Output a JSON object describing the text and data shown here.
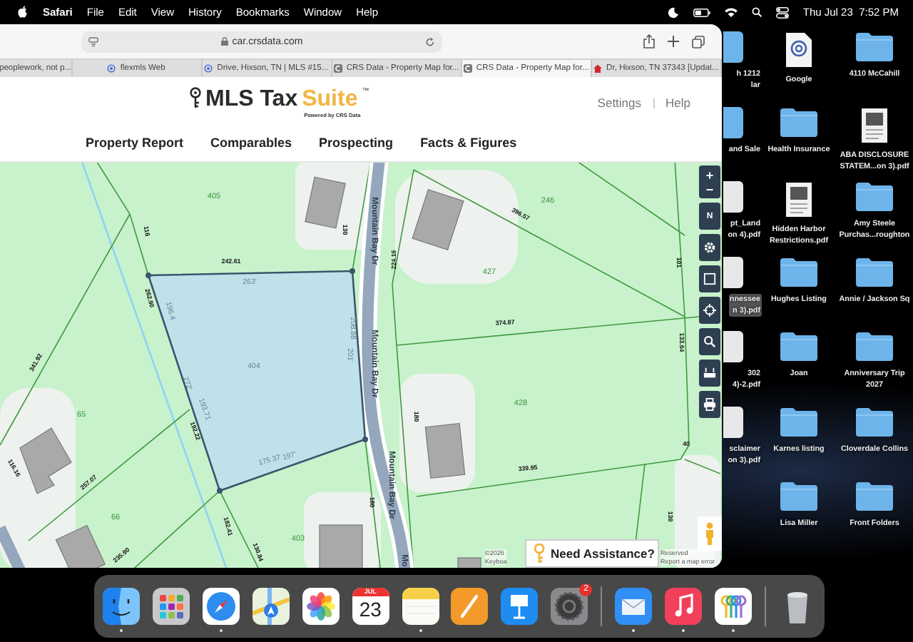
{
  "menubar": {
    "app": "Safari",
    "menus": [
      "File",
      "Edit",
      "View",
      "History",
      "Bookmarks",
      "Window",
      "Help"
    ],
    "clock": "Thu Jul 23  7:52 PM"
  },
  "browser": {
    "url": "car.crsdata.com",
    "tabs": [
      {
        "title": "peoplework, not p...",
        "kind": "plain",
        "selected": false
      },
      {
        "title": "flexmls Web",
        "kind": "pin",
        "selected": false
      },
      {
        "title": "Drive, Hixson, TN | MLS #15...",
        "kind": "pin",
        "selected": false
      },
      {
        "title": "CRS Data - Property Map for...",
        "kind": "crs",
        "selected": false
      },
      {
        "title": "CRS Data - Property Map for...",
        "kind": "crs",
        "selected": true
      },
      {
        "title": "Dr, Hixson, TN 37343 [Updat...",
        "kind": "house",
        "selected": false
      }
    ]
  },
  "site": {
    "logo": {
      "name": "MLS Tax",
      "accent": "Suite",
      "mark": "™",
      "tagline": "Powered by CRS Data"
    },
    "links": [
      "Settings",
      "Help"
    ],
    "nav": [
      "Property Report",
      "Comparables",
      "Prospecting",
      "Facts & Figures"
    ]
  },
  "map": {
    "labels": [
      {
        "text": "405",
        "kind": "lot"
      },
      {
        "text": "130",
        "kind": "dim"
      },
      {
        "text": "116",
        "kind": "dim"
      },
      {
        "text": "242.61",
        "kind": "dim"
      },
      {
        "text": "263'",
        "kind": "line"
      },
      {
        "text": "262.90",
        "kind": "dim"
      },
      {
        "text": "196.4",
        "kind": "line"
      },
      {
        "text": "208.88",
        "kind": "line"
      },
      {
        "text": "201'",
        "kind": "line"
      },
      {
        "text": "404",
        "kind": "line"
      },
      {
        "text": "Mountain Bay Dr",
        "kind": "street"
      },
      {
        "text": "Mountain Bay Dr",
        "kind": "street"
      },
      {
        "text": "Mountain Bay Dr",
        "kind": "street"
      },
      {
        "text": "224.16",
        "kind": "dim"
      },
      {
        "text": "246",
        "kind": "lot"
      },
      {
        "text": "396.57",
        "kind": "dim"
      },
      {
        "text": "427",
        "kind": "lot"
      },
      {
        "text": "374.87",
        "kind": "dim"
      },
      {
        "text": "428",
        "kind": "lot"
      },
      {
        "text": "180",
        "kind": "dim"
      },
      {
        "text": "339.95",
        "kind": "dim"
      },
      {
        "text": "341.92",
        "kind": "dim"
      },
      {
        "text": "272'",
        "kind": "line"
      },
      {
        "text": "193.71",
        "kind": "line"
      },
      {
        "text": "65",
        "kind": "lot"
      },
      {
        "text": "192.22",
        "kind": "dim"
      },
      {
        "text": "175.37",
        "kind": "line"
      },
      {
        "text": "197'",
        "kind": "line"
      },
      {
        "text": "116.16",
        "kind": "dim"
      },
      {
        "text": "257.07",
        "kind": "dim"
      },
      {
        "text": "66",
        "kind": "lot"
      },
      {
        "text": "182.41",
        "kind": "dim"
      },
      {
        "text": "403",
        "kind": "lot"
      },
      {
        "text": "130.84",
        "kind": "dim"
      },
      {
        "text": "180",
        "kind": "dim"
      },
      {
        "text": "235.90",
        "kind": "dim"
      },
      {
        "text": "133.64",
        "kind": "dim"
      },
      {
        "text": "40",
        "kind": "dim"
      },
      {
        "text": "130",
        "kind": "dim"
      },
      {
        "text": "101",
        "kind": "dim"
      },
      {
        "text": "Mo",
        "kind": "street"
      }
    ],
    "zoom": {
      "in": "+",
      "out": "−"
    },
    "compass": "N",
    "tools": [
      {
        "kind": "settings"
      },
      {
        "kind": "select"
      },
      {
        "kind": "locate"
      },
      {
        "kind": "search"
      },
      {
        "kind": "measure"
      },
      {
        "kind": "print"
      }
    ],
    "assist": "Need Assistance?",
    "attribution_left": [
      "©2026",
      "Keyboa"
    ],
    "attribution_right": [
      "Reserved",
      "Report a map error"
    ]
  },
  "desktop": {
    "columns": [
      {
        "items": [
          {
            "kind": "folder",
            "lines": [
              "h 1212",
              "lar"
            ],
            "selected": false
          },
          {
            "kind": "folder",
            "lines": [
              "and  Sale"
            ],
            "selected": false
          },
          {
            "kind": "document",
            "lines": [
              "pt_Land",
              "on 4).pdf"
            ],
            "selected": false
          },
          {
            "kind": "document",
            "lines": [
              "nnessee",
              "n 3).pdf"
            ],
            "selected": true
          },
          {
            "kind": "document",
            "lines": [
              "302",
              "4)-2.pdf"
            ],
            "selected": false
          },
          {
            "kind": "document",
            "lines": [
              "sclaimer",
              "on 3).pdf"
            ],
            "selected": false
          }
        ]
      },
      {
        "items": [
          {
            "kind": "link",
            "lines": [
              "Google"
            ],
            "selected": false
          },
          {
            "kind": "folder",
            "lines": [
              "Health Insurance"
            ],
            "selected": false
          },
          {
            "kind": "document",
            "lines": [
              "Hidden Harbor",
              "Restrictions.pdf"
            ],
            "selected": false
          },
          {
            "kind": "folder",
            "lines": [
              "Hughes Listing"
            ],
            "selected": false
          },
          {
            "kind": "folder",
            "lines": [
              "Joan"
            ],
            "selected": false
          },
          {
            "kind": "folder",
            "lines": [
              "Karnes listing"
            ],
            "selected": false
          },
          {
            "kind": "folder",
            "lines": [
              "Lisa Miller"
            ],
            "selected": false
          }
        ]
      },
      {
        "items": [
          {
            "kind": "folder",
            "lines": [
              "4110 McCahill"
            ],
            "selected": false
          },
          {
            "kind": "document",
            "lines": [
              "ABA DISCLOSURE",
              "STATEM...on 3).pdf"
            ],
            "selected": false
          },
          {
            "kind": "folder",
            "lines": [
              "Amy Steele",
              "Purchas...roughton"
            ],
            "selected": false
          },
          {
            "kind": "folder",
            "lines": [
              "Annie / Jackson Sq"
            ],
            "selected": false
          },
          {
            "kind": "folder",
            "lines": [
              "Anniversary Trip",
              "2027"
            ],
            "selected": false
          },
          {
            "kind": "folder",
            "lines": [
              "Cloverdale Collins"
            ],
            "selected": false
          },
          {
            "kind": "folder",
            "lines": [
              "Front Folders"
            ],
            "selected": false
          }
        ]
      }
    ]
  },
  "dock": {
    "items": [
      {
        "kind": "finder",
        "running": true
      },
      {
        "kind": "launchpad",
        "running": false
      },
      {
        "kind": "safari",
        "running": true
      },
      {
        "kind": "maps",
        "running": false
      },
      {
        "kind": "photos",
        "running": false
      },
      {
        "kind": "calendar",
        "running": false,
        "month": "JUL",
        "day": "23"
      },
      {
        "kind": "notes",
        "running": true
      },
      {
        "kind": "pages",
        "running": false
      },
      {
        "kind": "keynote",
        "running": false
      },
      {
        "kind": "settings",
        "running": false,
        "badge": "2"
      },
      {
        "kind": "separator"
      },
      {
        "kind": "mail",
        "running": true
      },
      {
        "kind": "music",
        "running": true
      },
      {
        "kind": "passwords",
        "running": true
      },
      {
        "kind": "separator"
      },
      {
        "kind": "trash",
        "running": false
      }
    ]
  }
}
